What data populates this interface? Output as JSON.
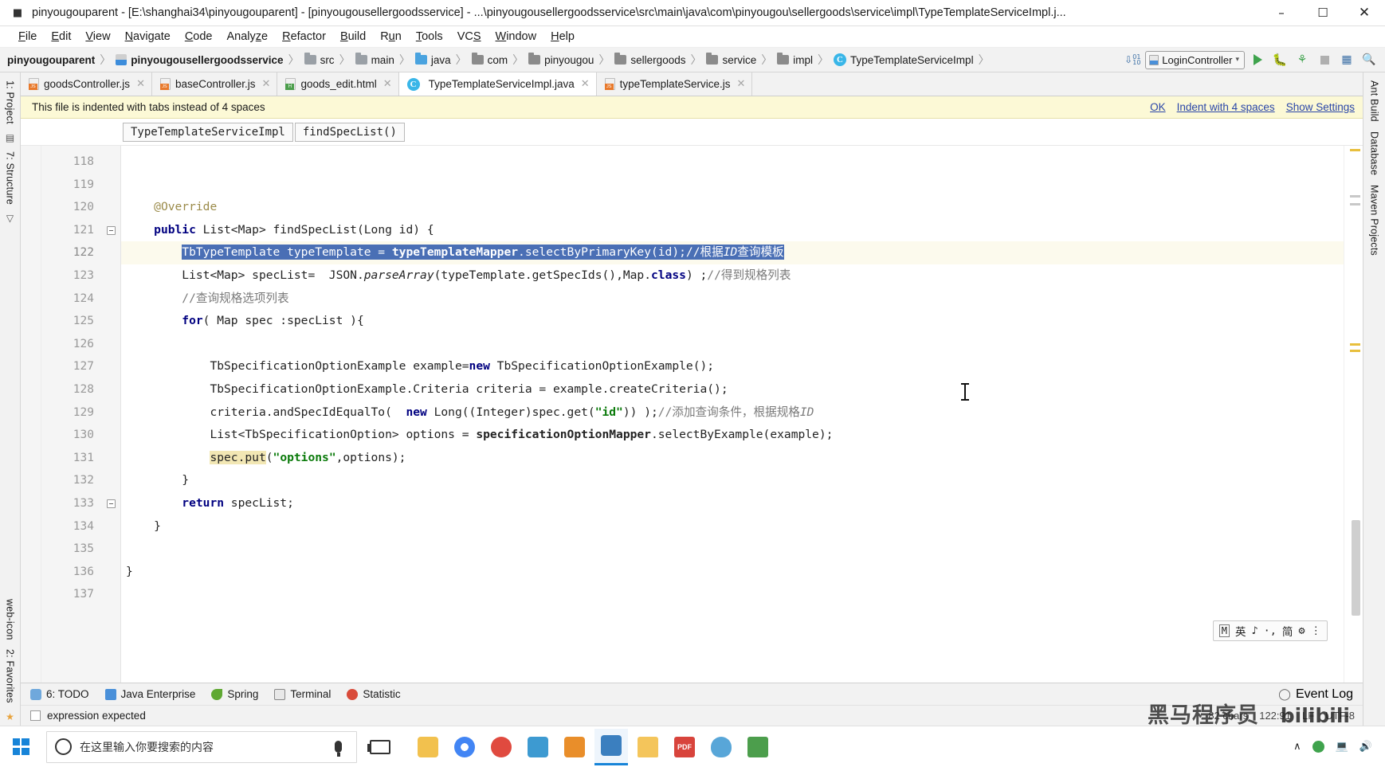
{
  "window": {
    "title": "pinyougouparent - [E:\\shanghai34\\pinyougouparent] - [pinyougousellergoodsservice] - ...\\pinyougousellergoodsservice\\src\\main\\java\\com\\pinyougou\\sellergoods\\service\\impl\\TypeTemplateServiceImpl.j...",
    "app_icon": "intellij-idea-icon",
    "minimize": "–",
    "maximize": "☐",
    "close": "✕"
  },
  "menubar": {
    "items": [
      {
        "label": "File"
      },
      {
        "label": "Edit"
      },
      {
        "label": "View"
      },
      {
        "label": "Navigate"
      },
      {
        "label": "Code"
      },
      {
        "label": "Analyze"
      },
      {
        "label": "Refactor"
      },
      {
        "label": "Build"
      },
      {
        "label": "Run"
      },
      {
        "label": "Tools"
      },
      {
        "label": "VCS"
      },
      {
        "label": "Window"
      },
      {
        "label": "Help"
      }
    ]
  },
  "navbar": {
    "crumbs": [
      {
        "label": "pinyougouparent",
        "icon": "none",
        "bold": true
      },
      {
        "label": "pinyougousellergoodsservice",
        "icon": "module-icon",
        "bold": true
      },
      {
        "label": "src",
        "icon": "folder-icon"
      },
      {
        "label": "main",
        "icon": "folder-icon"
      },
      {
        "label": "java",
        "icon": "folder-blue-icon"
      },
      {
        "label": "com",
        "icon": "folder-icon"
      },
      {
        "label": "pinyougou",
        "icon": "folder-icon"
      },
      {
        "label": "sellergoods",
        "icon": "folder-icon"
      },
      {
        "label": "service",
        "icon": "folder-icon"
      },
      {
        "label": "impl",
        "icon": "folder-icon"
      },
      {
        "label": "TypeTemplateServiceImpl",
        "icon": "class-icon"
      }
    ],
    "separator": "〉",
    "run_config": "LoginController",
    "run_config_caret": "▾",
    "toolbar_icons": [
      "sort-icon",
      "run-icon",
      "debug-icon",
      "run-coverage-icon",
      "stop-icon",
      "database-icon",
      "search-everywhere-icon"
    ]
  },
  "editor_tabs": [
    {
      "label": "goodsController.js",
      "icon": "js-file-icon",
      "active": false,
      "close": "✕"
    },
    {
      "label": "baseController.js",
      "icon": "js-file-icon",
      "active": false,
      "close": "✕"
    },
    {
      "label": "goods_edit.html",
      "icon": "html-file-icon",
      "active": false,
      "close": "✕"
    },
    {
      "label": "TypeTemplateServiceImpl.java",
      "icon": "java-class-icon",
      "active": true,
      "close": "✕"
    },
    {
      "label": "typeTemplateService.js",
      "icon": "js-file-icon",
      "active": false,
      "close": "✕"
    }
  ],
  "notification": {
    "message": "This file is indented with tabs instead of 4 spaces",
    "links": [
      "OK",
      "Indent with 4 spaces",
      "Show Settings"
    ]
  },
  "member_breadcrumb": {
    "class": "TypeTemplateServiceImpl",
    "method": "findSpecList()"
  },
  "left_rail": {
    "tabs": [
      "1: Project",
      "7: Structure",
      "2: Favorites"
    ],
    "icons": [
      "structure-icon",
      "bookmark-icon",
      "web-icon",
      "star-icon"
    ]
  },
  "right_rail": {
    "tabs": [
      "Ant Build",
      "Database",
      "Maven Projects"
    ]
  },
  "editor": {
    "first_line": 118,
    "lines": [
      {
        "n": 118,
        "text": ""
      },
      {
        "n": 119,
        "text": ""
      },
      {
        "n": 120,
        "text": "    @Override"
      },
      {
        "n": 121,
        "text": "    public List<Map> findSpecList(Long id) {"
      },
      {
        "n": 122,
        "text": "        TbTypeTemplate typeTemplate = typeTemplateMapper.selectByPrimaryKey(id);//根据ID查询模板"
      },
      {
        "n": 123,
        "text": "        List<Map> specList=  JSON.parseArray(typeTemplate.getSpecIds(),Map.class) ;//得到规格列表"
      },
      {
        "n": 124,
        "text": "        //查询规格选项列表"
      },
      {
        "n": 125,
        "text": "        for( Map spec :specList ){"
      },
      {
        "n": 126,
        "text": ""
      },
      {
        "n": 127,
        "text": "            TbSpecificationOptionExample example=new TbSpecificationOptionExample();"
      },
      {
        "n": 128,
        "text": "            TbSpecificationOptionExample.Criteria criteria = example.createCriteria();"
      },
      {
        "n": 129,
        "text": "            criteria.andSpecIdEqualTo(  new Long((Integer)spec.get(\"id\")) );//添加查询条件，根据规格ID"
      },
      {
        "n": 130,
        "text": "            List<TbSpecificationOption> options = specificationOptionMapper.selectByExample(example);"
      },
      {
        "n": 131,
        "text": "            spec.put(\"options\",options);"
      },
      {
        "n": 132,
        "text": "        }"
      },
      {
        "n": 133,
        "text": "        return specList;"
      },
      {
        "n": 134,
        "text": "    }"
      },
      {
        "n": 135,
        "text": ""
      },
      {
        "n": 136,
        "text": "}"
      },
      {
        "n": 137,
        "text": ""
      }
    ],
    "selected_line": 122,
    "selection_text": "TbTypeTemplate typeTemplate = typeTemplateMapper.selectByPrimaryKey(id);//根据ID查询模板"
  },
  "code_tokens": {
    "l120_annotation": "@Override",
    "l121_kw": "public",
    "l121_rest": " List<Map> findSpecList(Long id) {",
    "l122_a": "TbTypeTemplate typeTemplate = ",
    "l122_b": "typeTemplateMapper",
    "l122_c": ".selectByPrimaryKey(id);",
    "l122_d": "//根据",
    "l122_e": "ID",
    "l122_f": "查询模板",
    "l123_a": "List<Map> specList=  JSON.",
    "l123_b": "parseArray",
    "l123_c": "(typeTemplate.getSpecIds(),Map.",
    "l123_d": "class",
    "l123_e": ") ;",
    "l123_f": "//得到规格列表",
    "l124_comment": "//查询规格选项列表",
    "l125_kw": "for",
    "l125_rest": "( Map spec :specList ){",
    "l127_a": "TbSpecificationOptionExample example=",
    "l127_b": "new",
    "l127_c": " TbSpecificationOptionExample();",
    "l128_a": "TbSpecificationOptionExample.Criteria criteria = example.createCriteria();",
    "l129_a": "criteria.andSpecIdEqualTo(  ",
    "l129_b": "new",
    "l129_c": " Long((Integer)spec.get(",
    "l129_d": "\"id\"",
    "l129_e": ")) );",
    "l129_f": "//添加查询条件，根据规格",
    "l129_g": "ID",
    "l130_a": "List<TbSpecificationOption> options = ",
    "l130_b": "specificationOptionMapper",
    "l130_c": ".selectByExample(example);",
    "l131_a": "spec.put",
    "l131_b": "(",
    "l131_c": "\"options\"",
    "l131_d": ",options);",
    "l132": "}",
    "l133_kw": "return",
    "l133_rest": " specList;",
    "l134": "}",
    "l136": "}"
  },
  "ime": {
    "mode": "M",
    "lang": "英",
    "items": [
      "♪",
      "·,",
      "简"
    ],
    "gear": "⚙",
    "more": "⋮"
  },
  "bottom_tools": [
    {
      "label": "6: TODO",
      "icon": "todo-icon",
      "mnemonic": "6"
    },
    {
      "label": "Java Enterprise",
      "icon": "java-enterprise-icon"
    },
    {
      "label": "Spring",
      "icon": "spring-leaf-icon"
    },
    {
      "label": "Terminal",
      "icon": "terminal-icon"
    },
    {
      "label": "Statistic",
      "icon": "statistic-icon"
    }
  ],
  "bottom_right": {
    "event_log": "Event Log",
    "event_log_icon": "balloon-icon"
  },
  "statusbar": {
    "message": "expression expected",
    "caret_position": "122:91",
    "line_sep": "LF",
    "encoding": "UTF-8",
    "chars": "82 chars",
    "lock_icon": "lock-icon",
    "watermark": "黑马程序员",
    "watermark2": "bilibili"
  },
  "taskbar": {
    "start_icon": "windows-start-icon",
    "search_placeholder": "在这里输入你要搜索的内容",
    "search_icon": "search-circle-icon",
    "mic_icon": "microphone-icon",
    "taskview_icon": "task-view-icon",
    "apps": [
      {
        "name": "paint-app",
        "color": "#f2c14e"
      },
      {
        "name": "chrome-app",
        "color": "#4285f4"
      },
      {
        "name": "recorder-app",
        "color": "#e04a3f"
      },
      {
        "name": "editor-app",
        "color": "#3d9ad1"
      },
      {
        "name": "folder-orange-app",
        "color": "#e98e2a"
      },
      {
        "name": "intellij-app",
        "color": "#3b7fbf"
      },
      {
        "name": "explorer-app",
        "color": "#f4c55b"
      },
      {
        "name": "pdf-app",
        "color": "#d8443c"
      },
      {
        "name": "bird-app",
        "color": "#58a6d8"
      },
      {
        "name": "chart-app",
        "color": "#4c9e4c"
      }
    ],
    "tray": {
      "chevron": "∧",
      "net_icon": "network-icon",
      "sound_icon": "speaker-icon"
    }
  }
}
